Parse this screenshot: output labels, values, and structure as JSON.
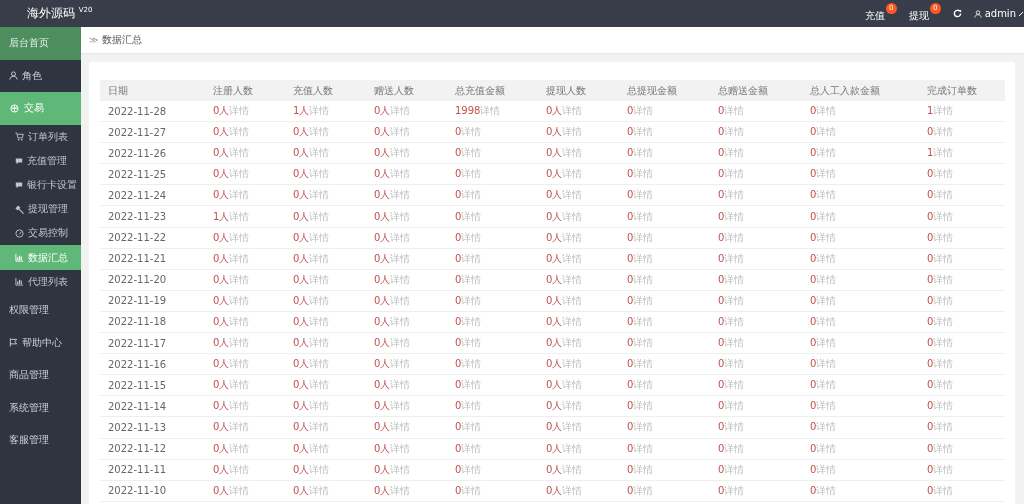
{
  "header": {
    "logo": "海外源码 $^{V20}$",
    "actions": [
      {
        "label": "充值",
        "badge": "0"
      },
      {
        "label": "提现",
        "badge": "0"
      }
    ],
    "user": "admin"
  },
  "sidebar": {
    "items": [
      {
        "label": "后台首页",
        "kind": "home",
        "selected": false
      },
      {
        "label": "角色",
        "kind": "link",
        "selected": false
      },
      {
        "label": "交易",
        "kind": "link",
        "selected": false,
        "expanded": true,
        "children": [
          {
            "label": "订单列表",
            "selected": false
          },
          {
            "label": "充值管理",
            "selected": false
          },
          {
            "label": "银行卡设置",
            "selected": false
          },
          {
            "label": "提现管理",
            "selected": false
          },
          {
            "label": "交易控制",
            "selected": false
          },
          {
            "label": "数据汇总",
            "selected": true
          },
          {
            "label": "代理列表",
            "selected": false
          }
        ]
      },
      {
        "label": "权限管理",
        "kind": "link",
        "selected": false
      },
      {
        "label": "帮助中心",
        "kind": "link",
        "selected": false
      },
      {
        "label": "商品管理",
        "kind": "link",
        "selected": false
      },
      {
        "label": "系统管理",
        "kind": "link",
        "selected": false
      },
      {
        "label": "客服管理",
        "kind": "link",
        "selected": false
      }
    ]
  },
  "breadcrumb": {
    "separator": "≫",
    "current": "数据汇总"
  },
  "table": {
    "columns": [
      "日期",
      "注册人数",
      "充值人数",
      "赠送人数",
      "总充值金额",
      "提现人数",
      "总提现金额",
      "总赠送金额",
      "总人工入款金额",
      "完成订单数"
    ],
    "rows": [
      {
        "cells": [
          {
            "value": "2022-11-28"
          },
          {
            "value": "0人",
            "link": "详情"
          },
          {
            "value": "1人",
            "link": "详情"
          },
          {
            "value": "0人",
            "link": "详情"
          },
          {
            "value": "1998",
            "link": "详情"
          },
          {
            "value": "0人",
            "link": "详情"
          },
          {
            "value": "0",
            "link": "详情"
          },
          {
            "value": "0",
            "link": "详情"
          },
          {
            "value": "0",
            "link": "详情"
          },
          {
            "value": "1",
            "link": "详情"
          }
        ]
      },
      {
        "cells": [
          {
            "value": "2022-11-27"
          },
          {
            "value": "0人",
            "link": "详情"
          },
          {
            "value": "0人",
            "link": "详情"
          },
          {
            "value": "0人",
            "link": "详情"
          },
          {
            "value": "0",
            "link": "详情"
          },
          {
            "value": "0人",
            "link": "详情"
          },
          {
            "value": "0",
            "link": "详情"
          },
          {
            "value": "0",
            "link": "详情"
          },
          {
            "value": "0",
            "link": "详情"
          },
          {
            "value": "0",
            "link": "详情"
          }
        ]
      },
      {
        "cells": [
          {
            "value": "2022-11-26"
          },
          {
            "value": "0人",
            "link": "详情"
          },
          {
            "value": "0人",
            "link": "详情"
          },
          {
            "value": "0人",
            "link": "详情"
          },
          {
            "value": "0",
            "link": "详情"
          },
          {
            "value": "0人",
            "link": "详情"
          },
          {
            "value": "0",
            "link": "详情"
          },
          {
            "value": "0",
            "link": "详情"
          },
          {
            "value": "0",
            "link": "详情"
          },
          {
            "value": "1",
            "link": "详情"
          }
        ]
      },
      {
        "cells": [
          {
            "value": "2022-11-25"
          },
          {
            "value": "0人",
            "link": "详情"
          },
          {
            "value": "0人",
            "link": "详情"
          },
          {
            "value": "0人",
            "link": "详情"
          },
          {
            "value": "0",
            "link": "详情"
          },
          {
            "value": "0人",
            "link": "详情"
          },
          {
            "value": "0",
            "link": "详情"
          },
          {
            "value": "0",
            "link": "详情"
          },
          {
            "value": "0",
            "link": "详情"
          },
          {
            "value": "0",
            "link": "详情"
          }
        ]
      },
      {
        "cells": [
          {
            "value": "2022-11-24"
          },
          {
            "value": "0人",
            "link": "详情"
          },
          {
            "value": "0人",
            "link": "详情"
          },
          {
            "value": "0人",
            "link": "详情"
          },
          {
            "value": "0",
            "link": "详情"
          },
          {
            "value": "0人",
            "link": "详情"
          },
          {
            "value": "0",
            "link": "详情"
          },
          {
            "value": "0",
            "link": "详情"
          },
          {
            "value": "0",
            "link": "详情"
          },
          {
            "value": "0",
            "link": "详情"
          }
        ]
      },
      {
        "cells": [
          {
            "value": "2022-11-23"
          },
          {
            "value": "1人",
            "link": "详情"
          },
          {
            "value": "0人",
            "link": "详情"
          },
          {
            "value": "0人",
            "link": "详情"
          },
          {
            "value": "0",
            "link": "详情"
          },
          {
            "value": "0人",
            "link": "详情"
          },
          {
            "value": "0",
            "link": "详情"
          },
          {
            "value": "0",
            "link": "详情"
          },
          {
            "value": "0",
            "link": "详情"
          },
          {
            "value": "0",
            "link": "详情"
          }
        ]
      },
      {
        "cells": [
          {
            "value": "2022-11-22"
          },
          {
            "value": "0人",
            "link": "详情"
          },
          {
            "value": "0人",
            "link": "详情"
          },
          {
            "value": "0人",
            "link": "详情"
          },
          {
            "value": "0",
            "link": "详情"
          },
          {
            "value": "0人",
            "link": "详情"
          },
          {
            "value": "0",
            "link": "详情"
          },
          {
            "value": "0",
            "link": "详情"
          },
          {
            "value": "0",
            "link": "详情"
          },
          {
            "value": "0",
            "link": "详情"
          }
        ]
      },
      {
        "cells": [
          {
            "value": "2022-11-21"
          },
          {
            "value": "0人",
            "link": "详情"
          },
          {
            "value": "0人",
            "link": "详情"
          },
          {
            "value": "0人",
            "link": "详情"
          },
          {
            "value": "0",
            "link": "详情"
          },
          {
            "value": "0人",
            "link": "详情"
          },
          {
            "value": "0",
            "link": "详情"
          },
          {
            "value": "0",
            "link": "详情"
          },
          {
            "value": "0",
            "link": "详情"
          },
          {
            "value": "0",
            "link": "详情"
          }
        ]
      },
      {
        "cells": [
          {
            "value": "2022-11-20"
          },
          {
            "value": "0人",
            "link": "详情"
          },
          {
            "value": "0人",
            "link": "详情"
          },
          {
            "value": "0人",
            "link": "详情"
          },
          {
            "value": "0",
            "link": "详情"
          },
          {
            "value": "0人",
            "link": "详情"
          },
          {
            "value": "0",
            "link": "详情"
          },
          {
            "value": "0",
            "link": "详情"
          },
          {
            "value": "0",
            "link": "详情"
          },
          {
            "value": "0",
            "link": "详情"
          }
        ]
      },
      {
        "cells": [
          {
            "value": "2022-11-19"
          },
          {
            "value": "0人",
            "link": "详情"
          },
          {
            "value": "0人",
            "link": "详情"
          },
          {
            "value": "0人",
            "link": "详情"
          },
          {
            "value": "0",
            "link": "详情"
          },
          {
            "value": "0人",
            "link": "详情"
          },
          {
            "value": "0",
            "link": "详情"
          },
          {
            "value": "0",
            "link": "详情"
          },
          {
            "value": "0",
            "link": "详情"
          },
          {
            "value": "0",
            "link": "详情"
          }
        ]
      },
      {
        "cells": [
          {
            "value": "2022-11-18"
          },
          {
            "value": "0人",
            "link": "详情"
          },
          {
            "value": "0人",
            "link": "详情"
          },
          {
            "value": "0人",
            "link": "详情"
          },
          {
            "value": "0",
            "link": "详情"
          },
          {
            "value": "0人",
            "link": "详情"
          },
          {
            "value": "0",
            "link": "详情"
          },
          {
            "value": "0",
            "link": "详情"
          },
          {
            "value": "0",
            "link": "详情"
          },
          {
            "value": "0",
            "link": "详情"
          }
        ]
      },
      {
        "cells": [
          {
            "value": "2022-11-17"
          },
          {
            "value": "0人",
            "link": "详情"
          },
          {
            "value": "0人",
            "link": "详情"
          },
          {
            "value": "0人",
            "link": "详情"
          },
          {
            "value": "0",
            "link": "详情"
          },
          {
            "value": "0人",
            "link": "详情"
          },
          {
            "value": "0",
            "link": "详情"
          },
          {
            "value": "0",
            "link": "详情"
          },
          {
            "value": "0",
            "link": "详情"
          },
          {
            "value": "0",
            "link": "详情"
          }
        ]
      },
      {
        "cells": [
          {
            "value": "2022-11-16"
          },
          {
            "value": "0人",
            "link": "详情"
          },
          {
            "value": "0人",
            "link": "详情"
          },
          {
            "value": "0人",
            "link": "详情"
          },
          {
            "value": "0",
            "link": "详情"
          },
          {
            "value": "0人",
            "link": "详情"
          },
          {
            "value": "0",
            "link": "详情"
          },
          {
            "value": "0",
            "link": "详情"
          },
          {
            "value": "0",
            "link": "详情"
          },
          {
            "value": "0",
            "link": "详情"
          }
        ]
      },
      {
        "cells": [
          {
            "value": "2022-11-15"
          },
          {
            "value": "0人",
            "link": "详情"
          },
          {
            "value": "0人",
            "link": "详情"
          },
          {
            "value": "0人",
            "link": "详情"
          },
          {
            "value": "0",
            "link": "详情"
          },
          {
            "value": "0人",
            "link": "详情"
          },
          {
            "value": "0",
            "link": "详情"
          },
          {
            "value": "0",
            "link": "详情"
          },
          {
            "value": "0",
            "link": "详情"
          },
          {
            "value": "0",
            "link": "详情"
          }
        ]
      },
      {
        "cells": [
          {
            "value": "2022-11-14"
          },
          {
            "value": "0人",
            "link": "详情"
          },
          {
            "value": "0人",
            "link": "详情"
          },
          {
            "value": "0人",
            "link": "详情"
          },
          {
            "value": "0",
            "link": "详情"
          },
          {
            "value": "0人",
            "link": "详情"
          },
          {
            "value": "0",
            "link": "详情"
          },
          {
            "value": "0",
            "link": "详情"
          },
          {
            "value": "0",
            "link": "详情"
          },
          {
            "value": "0",
            "link": "详情"
          }
        ]
      },
      {
        "cells": [
          {
            "value": "2022-11-13"
          },
          {
            "value": "0人",
            "link": "详情"
          },
          {
            "value": "0人",
            "link": "详情"
          },
          {
            "value": "0人",
            "link": "详情"
          },
          {
            "value": "0",
            "link": "详情"
          },
          {
            "value": "0人",
            "link": "详情"
          },
          {
            "value": "0",
            "link": "详情"
          },
          {
            "value": "0",
            "link": "详情"
          },
          {
            "value": "0",
            "link": "详情"
          },
          {
            "value": "0",
            "link": "详情"
          }
        ]
      },
      {
        "cells": [
          {
            "value": "2022-11-12"
          },
          {
            "value": "0人",
            "link": "详情"
          },
          {
            "value": "0人",
            "link": "详情"
          },
          {
            "value": "0人",
            "link": "详情"
          },
          {
            "value": "0",
            "link": "详情"
          },
          {
            "value": "0人",
            "link": "详情"
          },
          {
            "value": "0",
            "link": "详情"
          },
          {
            "value": "0",
            "link": "详情"
          },
          {
            "value": "0",
            "link": "详情"
          },
          {
            "value": "0",
            "link": "详情"
          }
        ]
      },
      {
        "cells": [
          {
            "value": "2022-11-11"
          },
          {
            "value": "0人",
            "link": "详情"
          },
          {
            "value": "0人",
            "link": "详情"
          },
          {
            "value": "0人",
            "link": "详情"
          },
          {
            "value": "0",
            "link": "详情"
          },
          {
            "value": "0人",
            "link": "详情"
          },
          {
            "value": "0",
            "link": "详情"
          },
          {
            "value": "0",
            "link": "详情"
          },
          {
            "value": "0",
            "link": "详情"
          },
          {
            "value": "0",
            "link": "详情"
          }
        ]
      },
      {
        "cells": [
          {
            "value": "2022-11-10"
          },
          {
            "value": "0人",
            "link": "详情"
          },
          {
            "value": "0人",
            "link": "详情"
          },
          {
            "value": "0人",
            "link": "详情"
          },
          {
            "value": "0",
            "link": "详情"
          },
          {
            "value": "0人",
            "link": "详情"
          },
          {
            "value": "0",
            "link": "详情"
          },
          {
            "value": "0",
            "link": "详情"
          },
          {
            "value": "0",
            "link": "详情"
          },
          {
            "value": "0",
            "link": "详情"
          }
        ]
      }
    ]
  }
}
